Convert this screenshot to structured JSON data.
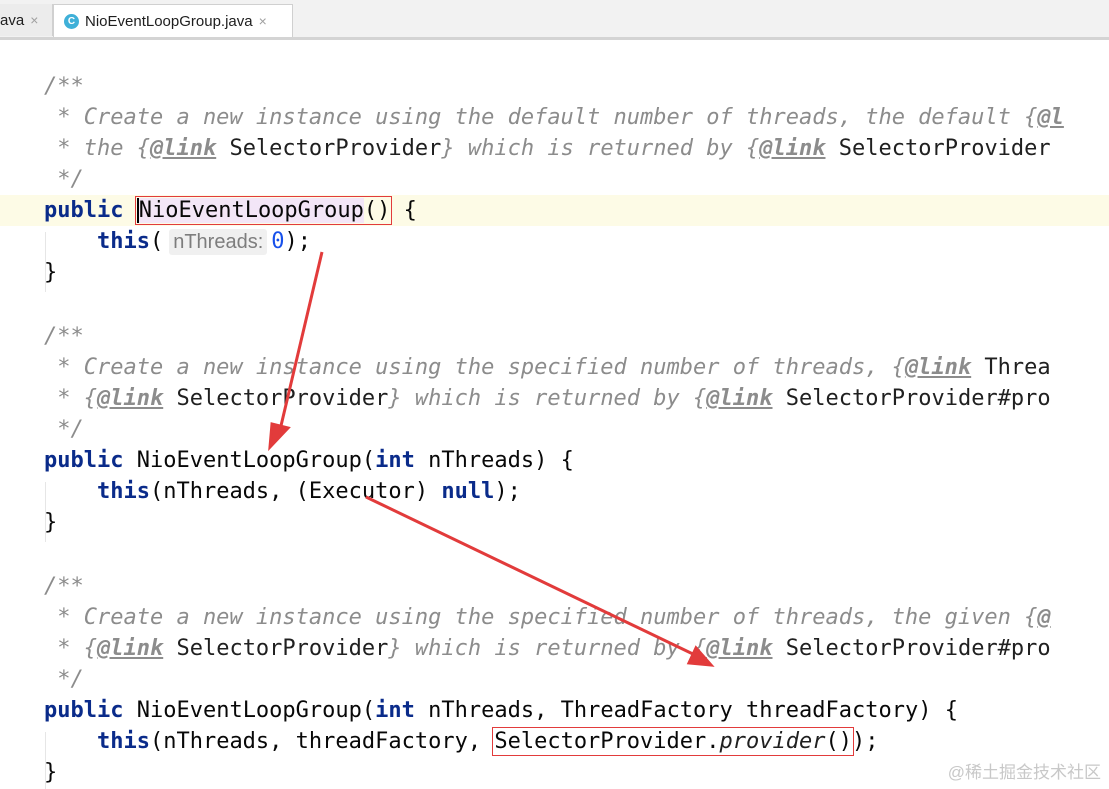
{
  "tabs": [
    {
      "label": "ava",
      "close": "×"
    },
    {
      "label": "NioEventLoopGroup.java",
      "close": "×",
      "icon": "C"
    }
  ],
  "code": {
    "doc1_open": "/**",
    "doc1_l1_a": " * Create a new instance using the default number of threads, the default {",
    "doc1_l1_tag": "@l",
    "doc1_l2_a": " * the {",
    "doc1_l2_tag": "@link",
    "doc1_l2_ref": " SelectorProvider",
    "doc1_l2_b": "} which is returned by {",
    "doc1_l2_tag2": "@link",
    "doc1_l2_ref2": " SelectorProvider",
    "doc1_close": " */",
    "kw_public": "public",
    "ctor_name": "NioEventLoopGroup",
    "paren_empty": "()",
    "brace_open": " {",
    "kw_this": "this",
    "hint_label": "nThreads:",
    "zero": "0",
    "call1_end": ");",
    "brace_close": "}",
    "doc2_open": "/**",
    "doc2_l1_a": " * Create a new instance using the specified number of threads, {",
    "doc2_l1_tag": "@link",
    "doc2_l1_ref": " Threa",
    "doc2_l2_a": " * {",
    "doc2_l2_tag": "@link",
    "doc2_l2_ref": " SelectorProvider",
    "doc2_l2_b": "} which is returned by {",
    "doc2_l2_tag2": "@link",
    "doc2_l2_ref2": " SelectorProvider#pro",
    "doc2_close": " */",
    "sig2_a": " NioEventLoopGroup(",
    "kw_int": "int",
    "sig2_b": " nThreads) {",
    "call2_a": "(nThreads, (Executor) ",
    "kw_null": "null",
    "call2_b": ");",
    "doc3_open": "/**",
    "doc3_l1_a": " * Create a new instance using the specified number of threads, the given {",
    "doc3_l1_tag": "@",
    "doc3_l2_a": " * {",
    "doc3_l2_tag": "@link",
    "doc3_l2_ref": " SelectorProvider",
    "doc3_l2_b": "} which is returned by {",
    "doc3_l2_tag2": "@link",
    "doc3_l2_ref2": " SelectorProvider#pro",
    "doc3_close": " */",
    "sig3_a": " NioEventLoopGroup(",
    "sig3_b": " nThreads, ThreadFactory threadFactory) {",
    "call3_a": "(nThreads, threadFactory, ",
    "call3_cls": "SelectorProvider.",
    "call3_method": "provider",
    "call3_paren": "()",
    "call3_end": ");"
  },
  "watermark": "@稀土掘金技术社区",
  "colors": {
    "keyword": "#0a2b8a",
    "comment": "#8c8c8c",
    "annotation_arrow": "#e23b3b",
    "number": "#1750eb"
  }
}
